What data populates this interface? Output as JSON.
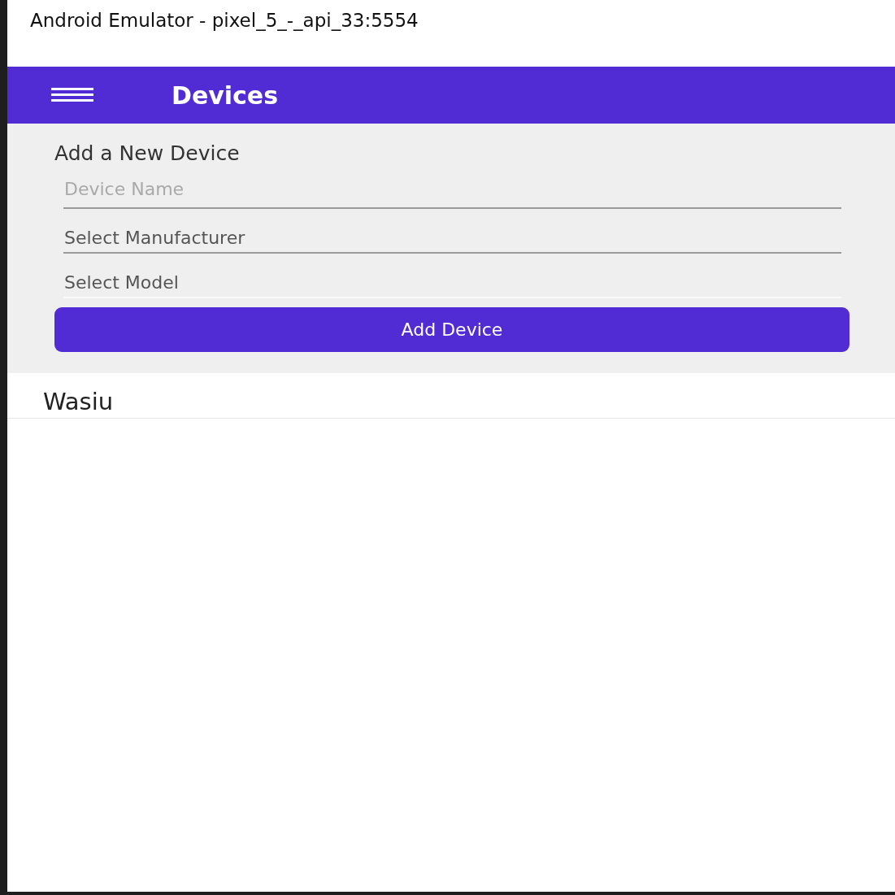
{
  "window": {
    "title": "Android Emulator - pixel_5_-_api_33:5554"
  },
  "app_bar": {
    "title": "Devices"
  },
  "form": {
    "heading": "Add a New Device",
    "fields": [
      {
        "kind": "entry",
        "placeholder": "Device Name"
      },
      {
        "kind": "picker",
        "label": "Select Manufacturer",
        "underline": true
      },
      {
        "kind": "picker",
        "label": "Select Model",
        "underline": false
      }
    ],
    "button": "Add Device"
  },
  "devices": [
    {
      "name": "Wasiu"
    }
  ]
}
